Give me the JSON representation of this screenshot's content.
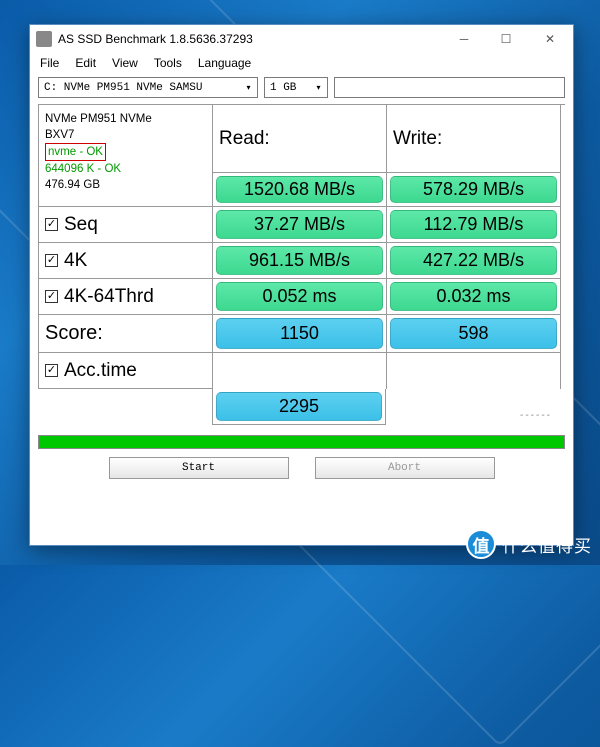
{
  "window": {
    "title": "AS SSD Benchmark 1.8.5636.37293"
  },
  "menu": {
    "file": "File",
    "edit": "Edit",
    "view": "View",
    "tools": "Tools",
    "language": "Language"
  },
  "toolbar": {
    "drive": "C: NVMe PM951 NVMe SAMSU",
    "size": "1 GB"
  },
  "info": {
    "model": "NVMe PM951 NVMe",
    "firmware": "BXV7",
    "driver": "nvme - OK",
    "alignment": "644096 K - OK",
    "capacity": "476.94 GB"
  },
  "headers": {
    "read": "Read:",
    "write": "Write:",
    "score": "Score:"
  },
  "rows": {
    "seq": {
      "label": "Seq",
      "read": "1520.68 MB/s",
      "write": "578.29 MB/s"
    },
    "k4": {
      "label": "4K",
      "read": "37.27 MB/s",
      "write": "112.79 MB/s"
    },
    "k4_64": {
      "label": "4K-64Thrd",
      "read": "961.15 MB/s",
      "write": "427.22 MB/s"
    },
    "acc": {
      "label": "Acc.time",
      "read": "0.052 ms",
      "write": "0.032 ms"
    }
  },
  "scores": {
    "read": "1150",
    "write": "598",
    "total": "2295"
  },
  "buttons": {
    "start": "Start",
    "abort": "Abort"
  },
  "watermark": {
    "logo": "值",
    "text": "什么值得买"
  },
  "chart_data": {
    "type": "table",
    "title": "AS SSD Benchmark Results",
    "drive": "NVMe PM951 NVMe SAMSU",
    "capacity_gb": 476.94,
    "test_size_gb": 1,
    "results": [
      {
        "test": "Seq",
        "read_mbs": 1520.68,
        "write_mbs": 578.29
      },
      {
        "test": "4K",
        "read_mbs": 37.27,
        "write_mbs": 112.79
      },
      {
        "test": "4K-64Thrd",
        "read_mbs": 961.15,
        "write_mbs": 427.22
      },
      {
        "test": "Acc.time",
        "read_ms": 0.052,
        "write_ms": 0.032
      }
    ],
    "scores": {
      "read": 1150,
      "write": 598,
      "total": 2295
    }
  }
}
